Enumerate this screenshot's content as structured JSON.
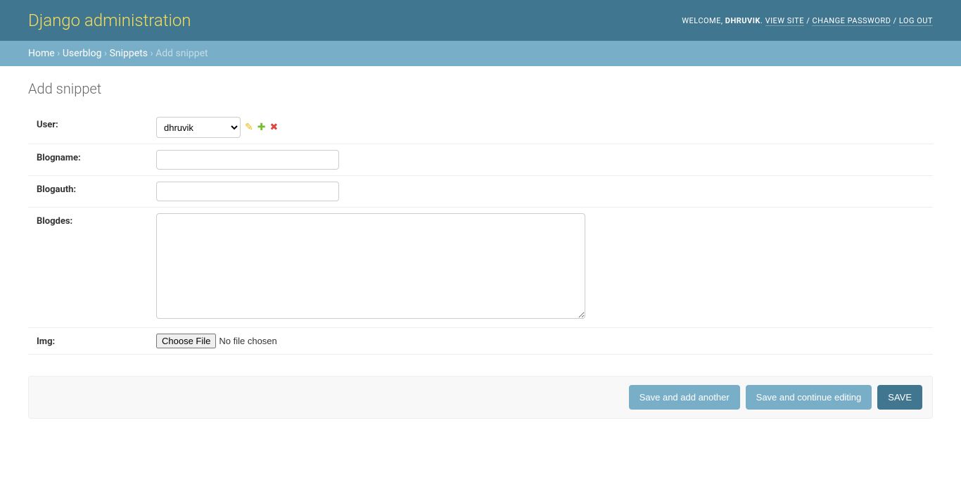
{
  "header": {
    "branding": "Django administration",
    "welcome": "WELCOME, ",
    "username": "DHRUVIK",
    "view_site": "VIEW SITE",
    "change_password": "CHANGE PASSWORD",
    "log_out": "LOG OUT"
  },
  "breadcrumbs": {
    "home": "Home",
    "app": "Userblog",
    "model": "Snippets",
    "current": "Add snippet"
  },
  "page_title": "Add snippet",
  "form": {
    "user": {
      "label": "User:",
      "selected": "dhruvik"
    },
    "blogname": {
      "label": "Blogname:",
      "value": ""
    },
    "blogauth": {
      "label": "Blogauth:",
      "value": ""
    },
    "blogdes": {
      "label": "Blogdes:",
      "value": ""
    },
    "img": {
      "label": "Img:",
      "button": "Choose File",
      "status": "No file chosen"
    }
  },
  "submit": {
    "add_another": "Save and add another",
    "continue": "Save and continue editing",
    "save": "SAVE"
  }
}
